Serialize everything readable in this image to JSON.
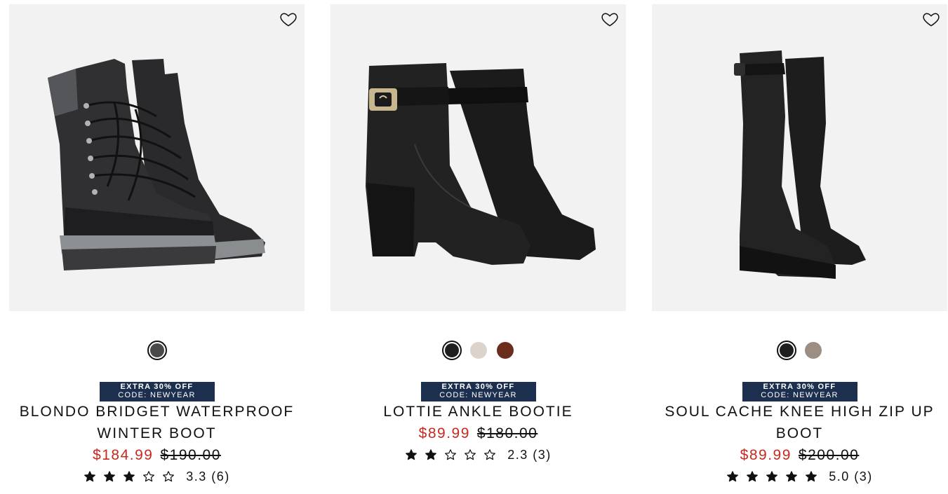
{
  "products": [
    {
      "name": "BLONDO BRIDGET WATERPROOF WINTER BOOT",
      "sale_price": "$184.99",
      "original_price": "$190.00",
      "rating_value": 3.3,
      "rating_text": "3.3",
      "review_count": "(6)",
      "stars": [
        1,
        1,
        1,
        0,
        0
      ],
      "promo_line1": "EXTRA 30% OFF",
      "promo_line2": "CODE: NEWYEAR",
      "swatches": [
        {
          "color": "#4a4a4c",
          "selected": true
        }
      ],
      "icon": "wishlist-heart-icon"
    },
    {
      "name": "LOTTIE ANKLE BOOTIE",
      "sale_price": "$89.99",
      "original_price": "$180.00",
      "rating_value": 2.3,
      "rating_text": "2.3",
      "review_count": "(3)",
      "stars": [
        1,
        1,
        0,
        0,
        0
      ],
      "promo_line1": "EXTRA 30% OFF",
      "promo_line2": "CODE: NEWYEAR",
      "swatches": [
        {
          "color": "#1f1f1f",
          "selected": true
        },
        {
          "color": "#dcd4ca",
          "selected": false
        },
        {
          "color": "#6b2e1c",
          "selected": false
        }
      ],
      "icon": "wishlist-heart-icon"
    },
    {
      "name": "SOUL CACHE KNEE HIGH ZIP UP BOOT",
      "sale_price": "$89.99",
      "original_price": "$200.00",
      "rating_value": 5.0,
      "rating_text": "5.0",
      "review_count": "(3)",
      "stars": [
        1,
        1,
        1,
        1,
        1
      ],
      "promo_line1": "EXTRA 30% OFF",
      "promo_line2": "CODE: NEWYEAR",
      "swatches": [
        {
          "color": "#1f1f1f",
          "selected": true
        },
        {
          "color": "#9c8e82",
          "selected": false
        }
      ],
      "icon": "wishlist-heart-icon"
    }
  ],
  "colors": {
    "sale": "#c8291f",
    "promo_bg": "#1c2f4e",
    "image_bg": "#f2f2f2"
  }
}
